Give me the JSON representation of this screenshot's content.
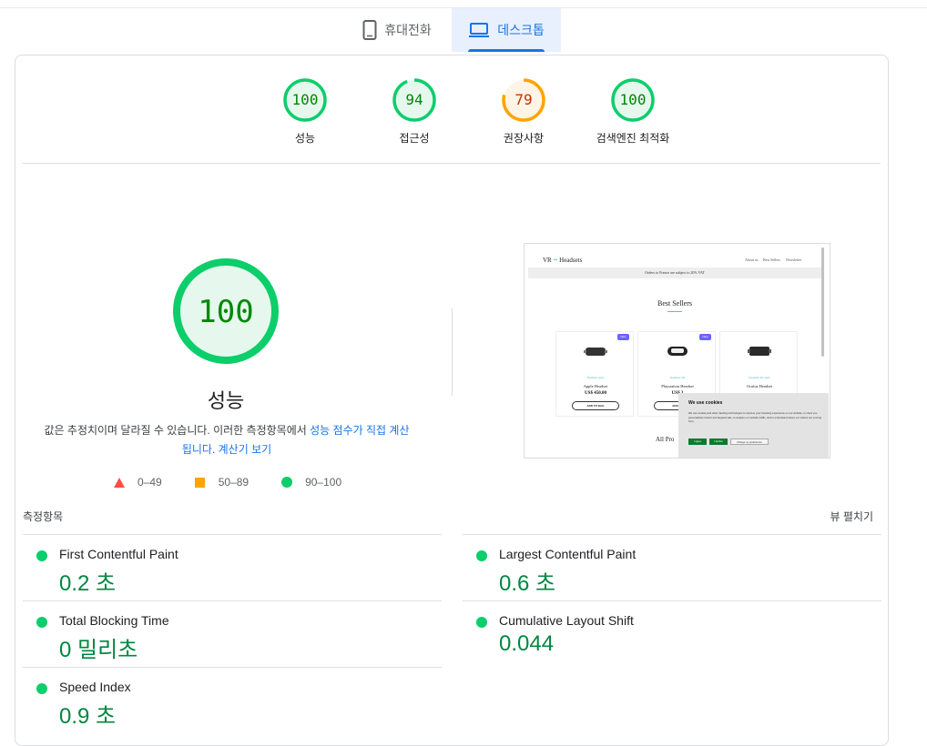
{
  "tabs": [
    {
      "label": "휴대전화",
      "icon": "phone-icon",
      "active": false
    },
    {
      "label": "데스크톱",
      "icon": "laptop-icon",
      "active": true
    }
  ],
  "categories": [
    {
      "label": "성능",
      "score": 100,
      "rating": "pass"
    },
    {
      "label": "접근성",
      "score": 94,
      "rating": "pass"
    },
    {
      "label": "권장사항",
      "score": 79,
      "rating": "average"
    },
    {
      "label": "검색엔진 최적화",
      "score": 100,
      "rating": "pass"
    }
  ],
  "colors": {
    "pass": "#0cce6b",
    "pass_text": "#008800",
    "pass_bg": "#e6f8ee",
    "average": "#ffa400",
    "average_text": "#c33300",
    "average_bg": "#fff4e5",
    "fail": "#ff4e42",
    "link": "#1a73e8"
  },
  "performance": {
    "score": 100,
    "title": "성능",
    "note_text": "값은 추정치이며 달라질 수 있습니다. 이러한 측정항목에서 ",
    "note_link1": "성능 점수가 직접 계산됩니다",
    "note_sep": ". ",
    "note_link2": "계산기 보기"
  },
  "legend": [
    {
      "range": "0–49",
      "shape": "triangle"
    },
    {
      "range": "50–89",
      "shape": "square"
    },
    {
      "range": "90–100",
      "shape": "circle"
    }
  ],
  "screenshot": {
    "logo_prefix": "VR",
    "logo_mid": " •• ",
    "logo_suffix": "Headsets",
    "nav": [
      "About us",
      "Best Sellers",
      "Newsletter"
    ],
    "banner": "Orders to France are subject to 20% VAT",
    "section_title": "Best Sellers",
    "products": [
      {
        "badge": "New",
        "category": "Realistic sight",
        "name": "Apple Headset",
        "price": "US$ 450.00",
        "button": "ADD TO BAG"
      },
      {
        "badge": "New",
        "category": "Realistic 3D",
        "name": "Playstation Headset",
        "price": "US$ 3",
        "button": "ADD TO"
      },
      {
        "badge": "",
        "category": "Realistic 3D sight",
        "name": "Oculus Headset",
        "price": "",
        "button": ""
      }
    ],
    "all_products": "All Pro",
    "cookie": {
      "title": "We use cookies",
      "text": "We use cookies and other tracking technologies to improve your browsing experience on our website, to show you personalized content and targeted ads, to analyze our website traffic, and to understand where our visitors are coming from.",
      "accept": "I agree",
      "decline": "I decline",
      "prefs": "Change my preferences"
    }
  },
  "metrics": {
    "header": "측정항목",
    "expand_label": "뷰 펼치기",
    "items": [
      {
        "name": "First Contentful Paint",
        "value": "0.2 초"
      },
      {
        "name": "Largest Contentful Paint",
        "value": "0.6 초"
      },
      {
        "name": "Total Blocking Time",
        "value": "0 밀리초"
      },
      {
        "name": "Cumulative Layout Shift",
        "value": "0.044"
      },
      {
        "name": "Speed Index",
        "value": "0.9 초"
      }
    ]
  }
}
